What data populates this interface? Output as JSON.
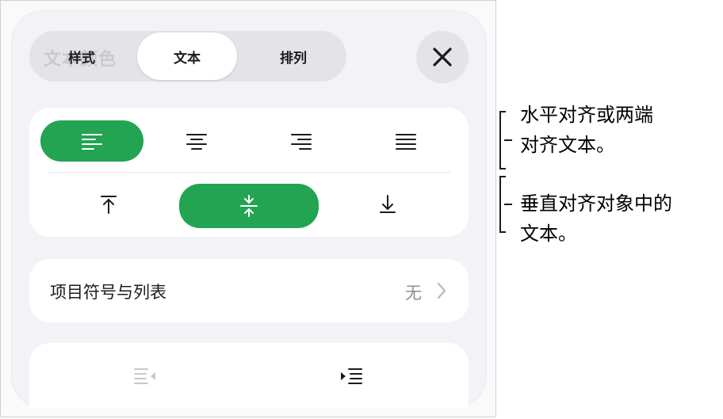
{
  "tabs": [
    {
      "label": "样式",
      "active": false
    },
    {
      "label": "文本",
      "active": true
    },
    {
      "label": "排列",
      "active": false
    }
  ],
  "ghost_text": "文本颜色",
  "close_button": {
    "icon": "close-icon"
  },
  "horizontal_alignment": [
    {
      "name": "align-left",
      "icon": "align-left-icon",
      "active": true
    },
    {
      "name": "align-center",
      "icon": "align-center-icon",
      "active": false
    },
    {
      "name": "align-right",
      "icon": "align-right-icon",
      "active": false
    },
    {
      "name": "justify",
      "icon": "justify-icon",
      "active": false
    }
  ],
  "vertical_alignment": [
    {
      "name": "align-top",
      "icon": "align-top-icon",
      "active": false
    },
    {
      "name": "align-middle",
      "icon": "align-middle-icon",
      "active": true
    },
    {
      "name": "align-bottom",
      "icon": "align-bottom-icon",
      "active": false
    }
  ],
  "bullets": {
    "label": "项目符号与列表",
    "value": "无"
  },
  "indent": [
    {
      "name": "decrease-indent",
      "icon": "decrease-indent-icon",
      "enabled": false
    },
    {
      "name": "increase-indent",
      "icon": "increase-indent-icon",
      "enabled": true
    }
  ],
  "callouts": {
    "horizontal": [
      "水平对齐或两端",
      "对齐文本。"
    ],
    "vertical": [
      "垂直对齐对象中的",
      "文本。"
    ]
  },
  "colors": {
    "accent": "#22a452",
    "panel": "#f2f2f7",
    "secondary_text": "#8e8e93"
  }
}
